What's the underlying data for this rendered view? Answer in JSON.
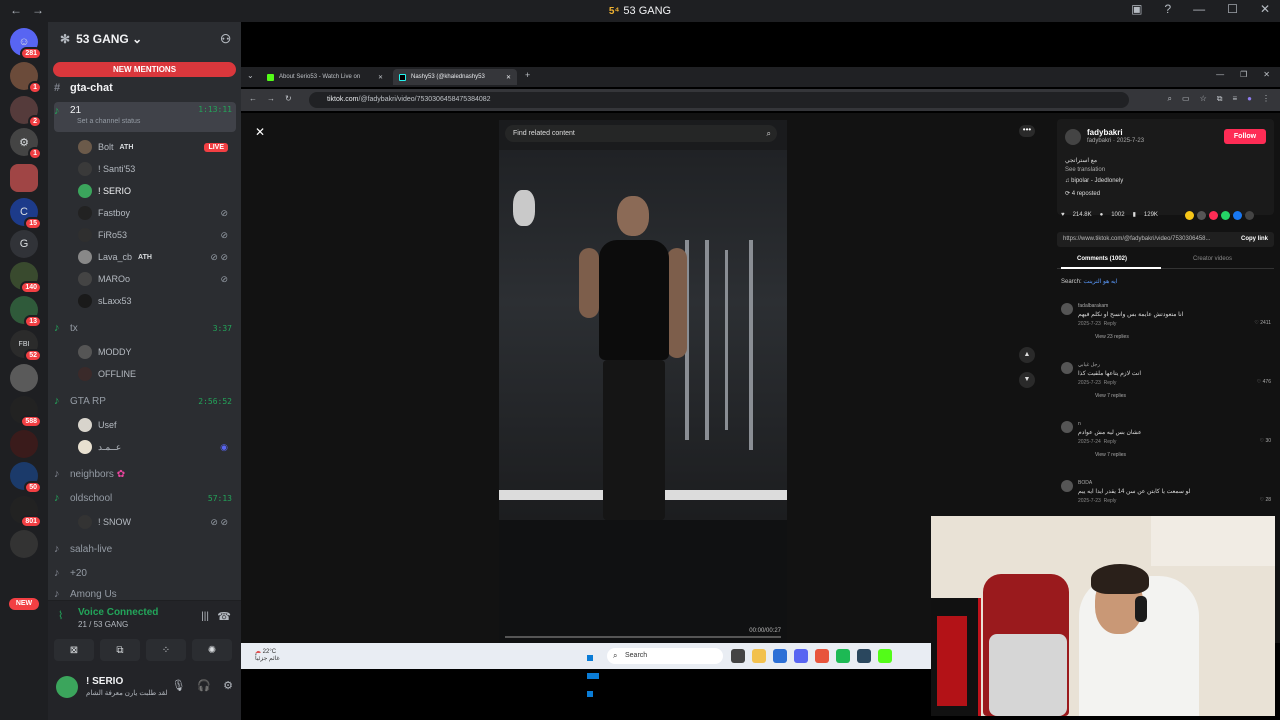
{
  "titlebar": {
    "app_title": "53 GANG",
    "badge": "5⁴"
  },
  "rail": {
    "items": [
      {
        "name": "discord-home",
        "badge": "281"
      },
      {
        "name": "server-1",
        "badge": "1"
      },
      {
        "name": "server-2",
        "badge": "2"
      },
      {
        "name": "server-3",
        "badge": "1"
      },
      {
        "name": "server-4",
        "badge": ""
      },
      {
        "name": "server-5",
        "badge": "15"
      },
      {
        "name": "server-g",
        "label": "G",
        "badge": ""
      },
      {
        "name": "server-7",
        "badge": "140"
      },
      {
        "name": "server-8",
        "badge": "13"
      },
      {
        "name": "server-fbi",
        "label": "FBI",
        "badge": "52"
      },
      {
        "name": "server-10",
        "badge": ""
      },
      {
        "name": "server-11",
        "badge": "588"
      },
      {
        "name": "server-12",
        "badge": ""
      },
      {
        "name": "server-13",
        "badge": "50"
      },
      {
        "name": "server-14",
        "badge": "801"
      },
      {
        "name": "server-15",
        "badge": ""
      }
    ],
    "new_label": "NEW"
  },
  "guild": {
    "name": "53 GANG",
    "mentions": "NEW MENTIONS"
  },
  "channels": {
    "gta_chat": "gta-chat",
    "c21": {
      "name": "21",
      "timer": "1:13:11",
      "status": "Set a channel status"
    },
    "c21_users": [
      {
        "name": "Bolt",
        "tag": "ATH",
        "live": "LIVE"
      },
      {
        "name": "! Santi'53",
        "tag": ""
      },
      {
        "name": "! SERIO",
        "tag": ""
      },
      {
        "name": "Fastboy",
        "tag": ""
      },
      {
        "name": "FiRo53",
        "tag": ""
      },
      {
        "name": "Lava_cb",
        "tag": "ATH"
      },
      {
        "name": "MAROo",
        "tag": ""
      },
      {
        "name": "sLaxx53",
        "tag": ""
      }
    ],
    "tx": {
      "name": "tx",
      "timer": "3:37"
    },
    "tx_users": [
      {
        "name": "MODDY"
      },
      {
        "name": "OFFLINE"
      }
    ],
    "gtarp": {
      "name": "GTA RP",
      "timer": "2:56:52"
    },
    "gtarp_users": [
      {
        "name": "Usef"
      },
      {
        "name": "عــمـد"
      }
    ],
    "neighbors": "neighbors",
    "oldschool": {
      "name": "oldschool",
      "timer": "57:13"
    },
    "oldschool_users": [
      {
        "name": "! SNOW"
      }
    ],
    "salah_live": "salah-live",
    "plus20": "+20",
    "among_us": "Among Us"
  },
  "voice": {
    "title": "Voice Connected",
    "sub": "21 / 53 GANG"
  },
  "me": {
    "name": "! SERIO",
    "status": "لقد طلبت يارن معرفة الشام"
  },
  "browser": {
    "tabs": [
      {
        "label": "About Serio53 - Watch Live on"
      },
      {
        "label": "Nashy53 (@khalednashy53"
      }
    ],
    "url_host": "tiktok.com",
    "url_path": "/@fadybakri/video/7530306458475384082"
  },
  "tiktok": {
    "search_placeholder": "Find related content",
    "video_time": "00:00/00:27",
    "author": {
      "name": "fadybakri",
      "meta": "fadybakri · 2025-7-23"
    },
    "follow": "Follow",
    "desc": [
      "مع استراتجي",
      "See translation",
      "bipolar - Jdedlonely",
      "4 reposted"
    ],
    "stats": {
      "likes": "214.8K",
      "comments": "1002",
      "saves": "129K"
    },
    "link": "https://www.tiktok.com/@fadybakri/video/7530306458...",
    "copy_link": "Copy link",
    "tab_comments": "Comments (1002)",
    "tab_creator": "Creator videos",
    "search_label": "Search:",
    "search_term": "ايه هو الترينت",
    "comments": [
      {
        "name": "fadalbarakam",
        "text": "انا متعودتش عايمة بس وانسح او نكلم فيهم",
        "date": "2025-7-23",
        "reply": "Reply",
        "likes": "2411",
        "replies": "View 23 replies"
      },
      {
        "name": "رجل غيابي",
        "text": "انت لازم يتاعها ملقيت كذا",
        "date": "2025-7-23",
        "reply": "Reply",
        "likes": "476",
        "replies": "View 7 replies"
      },
      {
        "name": "n",
        "text": "عشان بس ليه مش عوادم",
        "date": "2025-7-24",
        "reply": "Reply",
        "likes": "30",
        "replies": "View 7 replies"
      },
      {
        "name": "BODA",
        "text": "لو سمعت يا كابتن عن سن 14 يقدر ايدا ايه ييم",
        "date": "2025-7-23",
        "reply": "Reply",
        "likes": "28",
        "replies": ""
      }
    ]
  },
  "taskbar": {
    "weather_temp": "22°C",
    "weather_desc": "غائم جزئياً",
    "search": "Search"
  }
}
